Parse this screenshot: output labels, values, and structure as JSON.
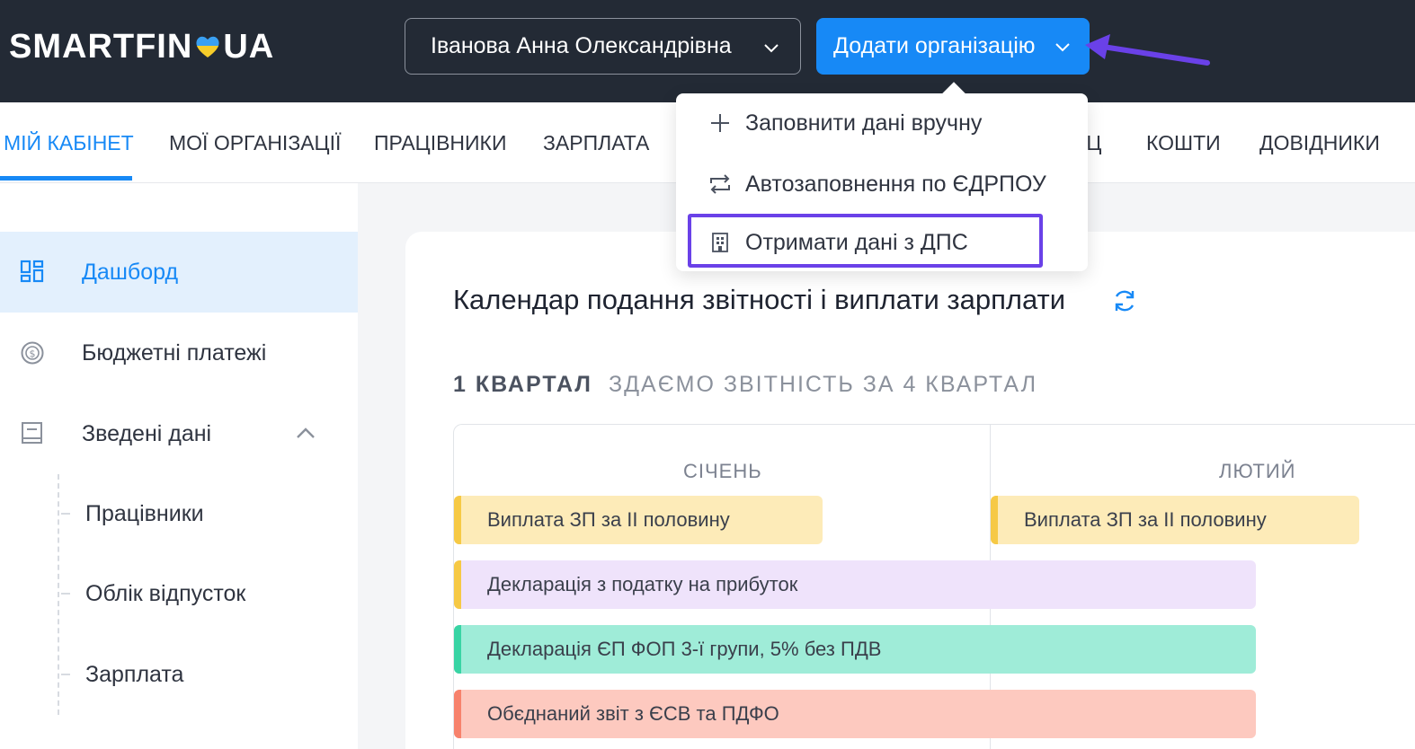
{
  "header": {
    "logo_left": "SMARTFIN",
    "logo_right": "UA",
    "user_name": "Іванова Анна Олександрівна",
    "add_org_label": "Додати організацію",
    "colors": {
      "bg": "#232a35",
      "primary": "#1789f6",
      "annotation": "#6a41e8"
    }
  },
  "dropdown": {
    "items": [
      {
        "label": "Заповнити дані вручну",
        "icon": "plus-icon"
      },
      {
        "label": "Автозаповнення по ЄДРПОУ",
        "icon": "swap-icon"
      },
      {
        "label": "Отримати дані з ДПС",
        "icon": "building-icon"
      }
    ]
  },
  "nav": {
    "items": [
      {
        "label": "МІЙ КАБІНЕТ",
        "active": true
      },
      {
        "label": "МОЇ ОРГАНІЗАЦІЇ"
      },
      {
        "label": "ПРАЦІВНИКИ"
      },
      {
        "label": "ЗАРПЛАТА"
      },
      {
        "label": "ІЦ"
      },
      {
        "label": "КОШТИ"
      },
      {
        "label": "ДОВІДНИКИ"
      }
    ]
  },
  "sidebar": {
    "items": [
      {
        "label": "Дашборд",
        "icon": "dashboard-icon",
        "active": true
      },
      {
        "label": "Бюджетні платежі",
        "icon": "dollar-coin-icon"
      },
      {
        "label": "Зведені дані",
        "icon": "book-icon",
        "expanded": true
      }
    ],
    "subitems": [
      {
        "label": "Працівники"
      },
      {
        "label": "Облік відпусток"
      },
      {
        "label": "Зарплата"
      }
    ]
  },
  "calendar": {
    "title": "Календар подання звітності і виплати зарплати",
    "quarter": "1 КВАРТАЛ",
    "quarter_sub": "ЗДАЄМО ЗВІТНІСТЬ ЗА 4 КВАРТАЛ",
    "months": [
      "СІЧЕНЬ",
      "ЛЮТИЙ"
    ],
    "events": [
      {
        "label": "Виплата ЗП за ІІ половину",
        "bg": "#fdebb8",
        "bar": "#f6c945"
      },
      {
        "label": "Виплата ЗП за ІІ половину",
        "bg": "#fdebb8",
        "bar": "#f6c945"
      },
      {
        "label": "Декларація з податку на прибуток",
        "bg": "#efe3fb",
        "bar": "#f6c945"
      },
      {
        "label": "Декларація ЄП ФОП 3-ї групи, 5% без ПДВ",
        "bg": "#9fecd8",
        "bar": "#38d4a4"
      },
      {
        "label": "Обєднаний звіт з ЄСВ та ПДФО",
        "bg": "#fdc9bf",
        "bar": "#f7826c"
      }
    ]
  }
}
